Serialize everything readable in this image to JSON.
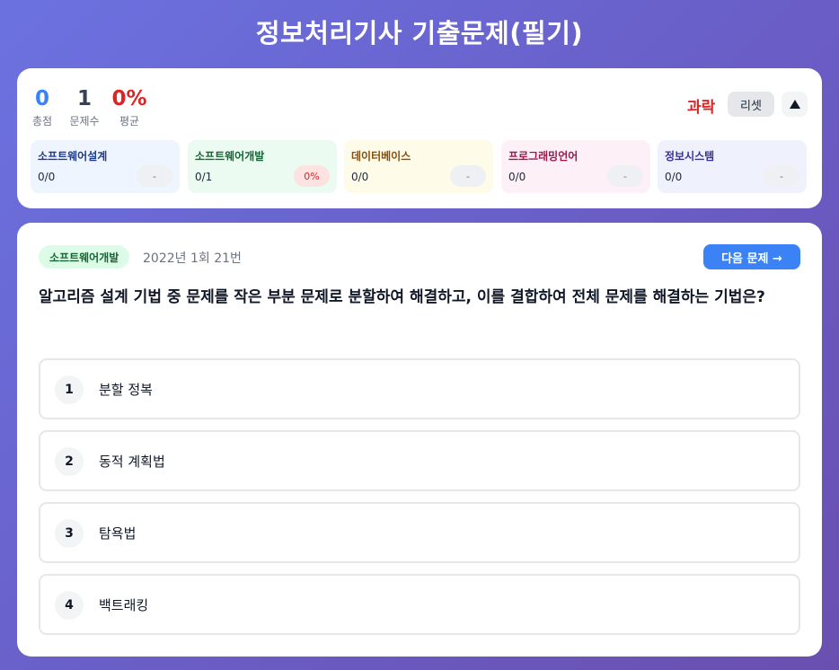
{
  "title": "정보처리기사 기출문제(필기)",
  "stats": {
    "total": {
      "value": "0",
      "label": "총점"
    },
    "count": {
      "value": "1",
      "label": "문제수"
    },
    "average": {
      "value": "0%",
      "label": "평균"
    },
    "grade": "과락",
    "reset_label": "리셋",
    "collapse_icon": "triangle-up-icon"
  },
  "categories": [
    {
      "name": "소프트웨어설계",
      "score": "0/0",
      "percent": "-"
    },
    {
      "name": "소프트웨어개발",
      "score": "0/1",
      "percent": "0%"
    },
    {
      "name": "데이터베이스",
      "score": "0/0",
      "percent": "-"
    },
    {
      "name": "프로그래밍언어",
      "score": "0/0",
      "percent": "-"
    },
    {
      "name": "정보시스템",
      "score": "0/0",
      "percent": "-"
    }
  ],
  "quiz": {
    "tag": "소프트웨어개발",
    "meta": "2022년 1회 21번",
    "next_label": "다음 문제 →",
    "question": "알고리즘 설계 기법 중 문제를 작은 부분 문제로 분할하여 해결하고, 이를 결합하여 전체 문제를 해결하는 기법은?",
    "options": [
      {
        "num": "1",
        "text": "분할 정복"
      },
      {
        "num": "2",
        "text": "동적 계획법"
      },
      {
        "num": "3",
        "text": "탐욕법"
      },
      {
        "num": "4",
        "text": "백트래킹"
      }
    ]
  },
  "colors": {
    "accent": "#3b82f6",
    "danger": "#dc2626",
    "background_start": "#6b72e0",
    "background_end": "#6a4fb0"
  }
}
